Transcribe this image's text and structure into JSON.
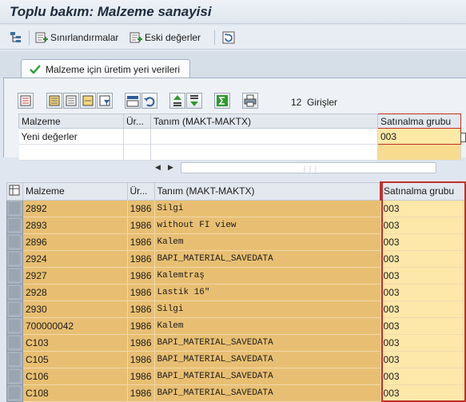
{
  "window": {
    "title": "Toplu bakım: Malzeme sanayisi"
  },
  "toolbar": {
    "restrictions_label": "Sınırlandırmalar",
    "old_values_label": "Eski değerler"
  },
  "tab": {
    "label": "Malzeme için üretim yeri verileri"
  },
  "alv": {
    "entries_count": "12",
    "entries_label": "Girişler"
  },
  "upper_table": {
    "headers": [
      "Malzeme",
      "Ür...",
      "Tanım (MAKT-MAKTX)",
      "Satınalma grubu"
    ],
    "new_values_label": "Yeni değerler",
    "new_purch_group_value": "003"
  },
  "lower_table": {
    "headers": [
      "Malzeme",
      "Ür...",
      "Tanım (MAKT-MAKTX)",
      "Satınalma grubu"
    ],
    "rows": [
      {
        "material": "2892",
        "plant": "1986",
        "desc": "Silgi",
        "purch": "003"
      },
      {
        "material": "2893",
        "plant": "1986",
        "desc": "without FI view",
        "purch": "003"
      },
      {
        "material": "2896",
        "plant": "1986",
        "desc": "Kalem",
        "purch": "003"
      },
      {
        "material": "2924",
        "plant": "1986",
        "desc": "BAPI_MATERIAL_SAVEDATA",
        "purch": "003"
      },
      {
        "material": "2927",
        "plant": "1986",
        "desc": "Kalemtraş",
        "purch": "003"
      },
      {
        "material": "2928",
        "plant": "1986",
        "desc": "Lastik 16\"",
        "purch": "003"
      },
      {
        "material": "2930",
        "plant": "1986",
        "desc": "Silgi",
        "purch": "003"
      },
      {
        "material": "700000042",
        "plant": "1986",
        "desc": "Kalem",
        "purch": "003"
      },
      {
        "material": "C103",
        "plant": "1986",
        "desc": "BAPI_MATERIAL_SAVEDATA",
        "purch": "003"
      },
      {
        "material": "C105",
        "plant": "1986",
        "desc": "BAPI_MATERIAL_SAVEDATA",
        "purch": "003"
      },
      {
        "material": "C106",
        "plant": "1986",
        "desc": "BAPI_MATERIAL_SAVEDATA",
        "purch": "003"
      },
      {
        "material": "C108",
        "plant": "1986",
        "desc": "BAPI_MATERIAL_SAVEDATA",
        "purch": "003"
      }
    ]
  },
  "colors": {
    "highlight_border": "#c2302b",
    "row_fill": "#e8bf72",
    "purch_fill": "#fde7a9"
  }
}
